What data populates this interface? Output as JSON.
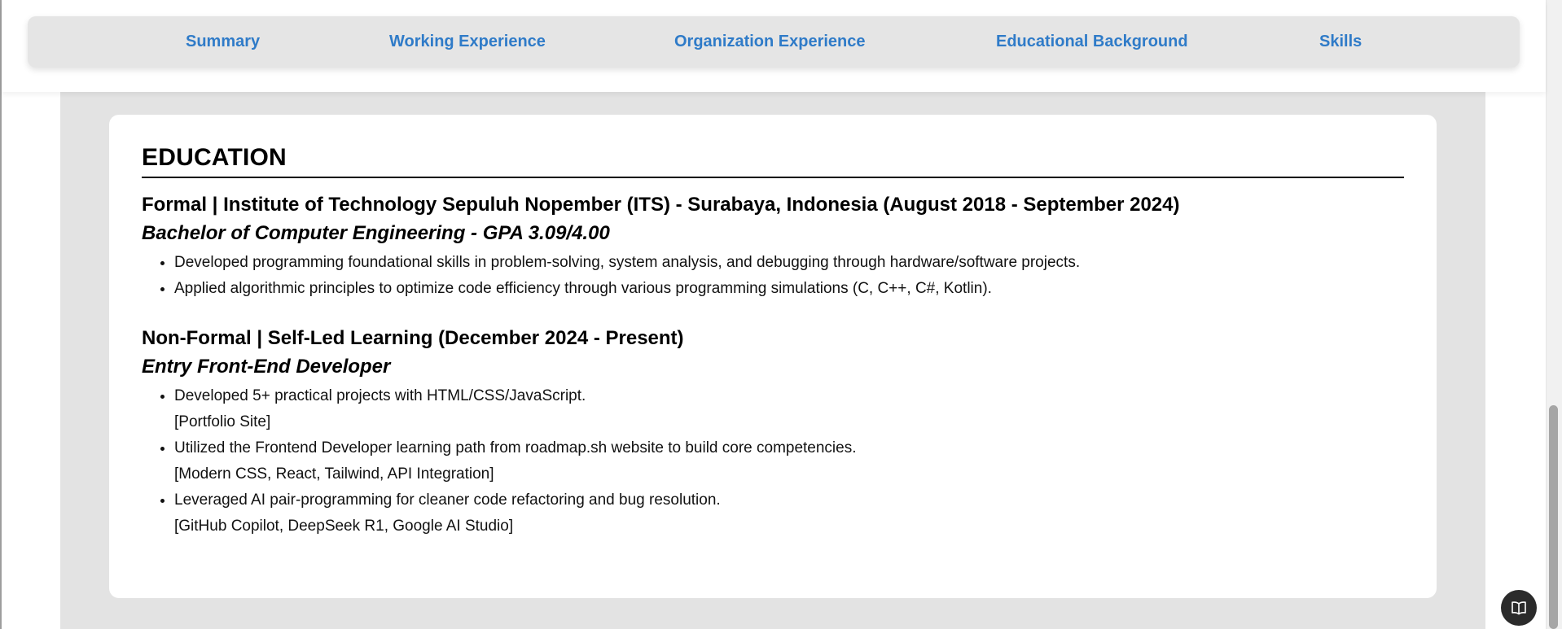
{
  "nav": {
    "items": [
      {
        "label": "Summary"
      },
      {
        "label": "Working Experience"
      },
      {
        "label": "Organization Experience"
      },
      {
        "label": "Educational Background"
      },
      {
        "label": "Skills"
      }
    ]
  },
  "education": {
    "title": "EDUCATION",
    "entries": [
      {
        "heading": "Formal | Institute of Technology Sepuluh Nopember (ITS) - Surabaya, Indonesia (August 2018 - September 2024)",
        "subheading": "Bachelor of Computer Engineering - GPA 3.09/4.00",
        "bullets": [
          {
            "text": "Developed programming foundational skills in problem-solving, system analysis, and debugging through hardware/software projects."
          },
          {
            "text": "Applied algorithmic principles to optimize code efficiency through various programming simulations (C, C++, C#, Kotlin)."
          }
        ]
      },
      {
        "heading": "Non-Formal | Self-Led Learning (December 2024 - Present)",
        "subheading": "Entry Front-End Developer",
        "bullets": [
          {
            "text": "Developed 5+ practical projects with HTML/CSS/JavaScript.",
            "tools": "[Portfolio Site]"
          },
          {
            "text": "Utilized the Frontend Developer learning path from roadmap.sh website to build core competencies.",
            "tools": "[Modern CSS, React, Tailwind, API Integration]"
          },
          {
            "text": "Leveraged AI pair-programming for cleaner code refactoring and bug resolution.",
            "tools": "[GitHub Copilot, DeepSeek R1, Google AI Studio]"
          }
        ]
      }
    ]
  },
  "widgets": {
    "floating_button_icon": "book-open-icon"
  },
  "colors": {
    "nav_link": "#2f7bc8",
    "page_background": "#e3e3e3",
    "card_background": "#ffffff",
    "fab_background": "#2b2b2b"
  }
}
